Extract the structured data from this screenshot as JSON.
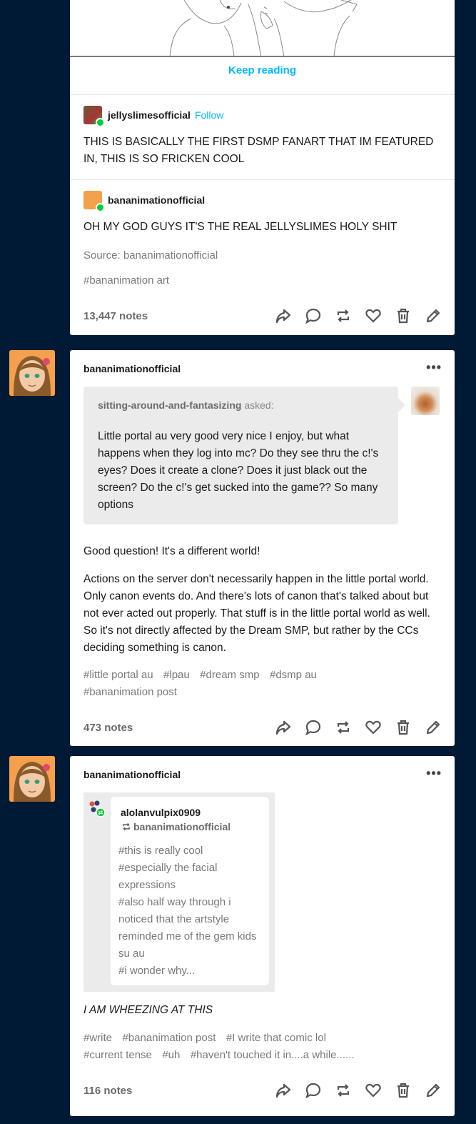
{
  "post1": {
    "keep_reading": "Keep reading",
    "reblog1": {
      "blog": "jellyslimesofficial",
      "follow": "Follow",
      "text": "THIS IS BASICALLY THE FIRST DSMP FANART THAT IM FEATURED IN, THIS IS SO FRICKEN COOL"
    },
    "reblog2": {
      "blog": "bananimationofficial",
      "text": "OH MY GOD GUYS IT'S THE REAL JELLYSLIMES HOLY SHIT"
    },
    "source": "Source: bananimationofficial",
    "tags": [
      "#bananimation art"
    ],
    "notes": "13,447 notes"
  },
  "post2": {
    "blog": "bananimationofficial",
    "asker": "sitting-around-and-fantasizing",
    "asked": " asked:",
    "question": "Little portal au very good very nice I enjoy, but what happens when they log into mc? Do they see thru the c!'s eyes? Does it create a clone? Does it just black out the screen? Do the c!'s get sucked into the game?? So many options",
    "answer1": "Good question! It's a different world!",
    "answer2": "Actions on the server don't necessarily happen in the little portal world. Only canon events do. And there's lots of canon that's talked about but not ever acted out properly. That stuff is in the little portal world as well. So it's not directly affected by the Dream SMP, but rather by the CCs deciding something is canon.",
    "tags": [
      "#little portal au",
      "#lpau",
      "#dream smp",
      "#dsmp au",
      "#bananimation post"
    ],
    "notes": "473 notes",
    "more": "•••"
  },
  "post3": {
    "blog": "bananimationofficial",
    "more": "•••",
    "embedded": {
      "blog": "alolanvulpix0909",
      "reblogged_from": "bananimationofficial",
      "tags": [
        "#this is really cool",
        "#especially the facial expressions",
        "#also half way through i noticed that the artstyle reminded me of the gem kids su au",
        "#i wonder why..."
      ]
    },
    "text": "I AM WHEEZING AT THIS",
    "tags": [
      "#write",
      "#bananimation post",
      "#I write that comic lol",
      "#current tense",
      "#uh",
      "#haven't touched it in....a while......"
    ],
    "notes": "116 notes"
  },
  "colors": {
    "background": "#001935",
    "accent_blue": "#00b8ff",
    "reblog_green": "#00cf35",
    "avatar_orange": "#f4a04c"
  },
  "icons": [
    "share-icon",
    "reply-icon",
    "reblog-icon",
    "like-icon",
    "delete-icon",
    "edit-icon"
  ]
}
